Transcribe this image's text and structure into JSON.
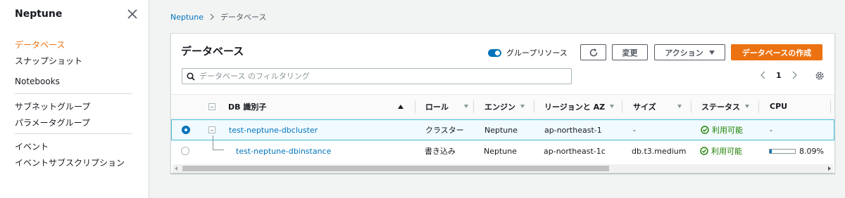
{
  "sidebar": {
    "title": "Neptune",
    "items": [
      {
        "label": "データベース",
        "active": true
      },
      {
        "label": "スナップショット"
      },
      {
        "label": "Notebooks"
      },
      {
        "label": "サブネットグループ"
      },
      {
        "label": "パラメータグループ"
      },
      {
        "label": "イベント"
      },
      {
        "label": "イベントサブスクリプション"
      }
    ]
  },
  "breadcrumb": {
    "root": "Neptune",
    "current": "データベース"
  },
  "panel": {
    "title": "データベース",
    "group_toggle_label": "グループリソース",
    "buttons": {
      "modify": "変更",
      "actions": "アクション",
      "create": "データベースの作成"
    },
    "search": {
      "placeholder": "データベース のフィルタリング"
    },
    "pagination": {
      "page": "1"
    }
  },
  "table": {
    "columns": {
      "db_id": "DB 識別子",
      "role": "ロール",
      "engine": "エンジン",
      "region": "リージョンと AZ",
      "size": "サイズ",
      "status": "ステータス",
      "cpu": "CPU"
    },
    "rows": [
      {
        "selected": true,
        "db_id": "test-neptune-dbcluster",
        "role": "クラスター",
        "engine": "Neptune",
        "region": "ap-northeast-1",
        "size": "-",
        "status": "利用可能",
        "cpu": "-"
      },
      {
        "selected": false,
        "db_id": "test-neptune-dbinstance",
        "role": "書き込み",
        "engine": "Neptune",
        "region": "ap-northeast-1c",
        "size": "db.t3.medium",
        "status": "利用可能",
        "cpu": "8.09%",
        "cpu_fraction": 0.0809
      }
    ]
  },
  "colors": {
    "accent": "#ec7211",
    "link": "#0073bb",
    "success": "#1d8102"
  }
}
